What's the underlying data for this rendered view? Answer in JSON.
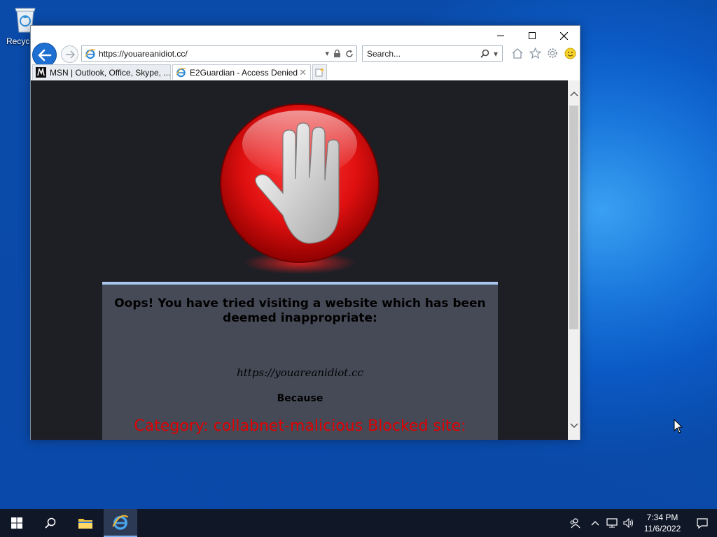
{
  "desktop": {
    "recycle_bin_label": "Recycl"
  },
  "browser": {
    "address": {
      "url": "https://youareanidiot.cc/"
    },
    "search": {
      "placeholder": "Search..."
    },
    "tabs": [
      {
        "label": "MSN | Outlook, Office, Skype, ...",
        "active": false,
        "icon": "msn-icon"
      },
      {
        "label": "E2Guardian - Access Denied",
        "active": true,
        "icon": "ie-icon"
      }
    ],
    "window_controls": {
      "minimize": "─",
      "maximize": "☐",
      "close": "✕"
    }
  },
  "page": {
    "heading": "Oops! You have tried visiting a website which has been deemed inappropriate:",
    "blocked_url": "https://youareanidiot.cc",
    "because": "Because",
    "reason": "Category: collabnet-malicious  Blocked site:"
  },
  "taskbar": {
    "clock_time": "7:34 PM",
    "clock_date": "11/6/2022"
  },
  "colors": {
    "accent": "#1d6fd1",
    "stop_red": "#e00000",
    "panel_bg": "#464a57",
    "content_bg": "#1e1f25"
  }
}
